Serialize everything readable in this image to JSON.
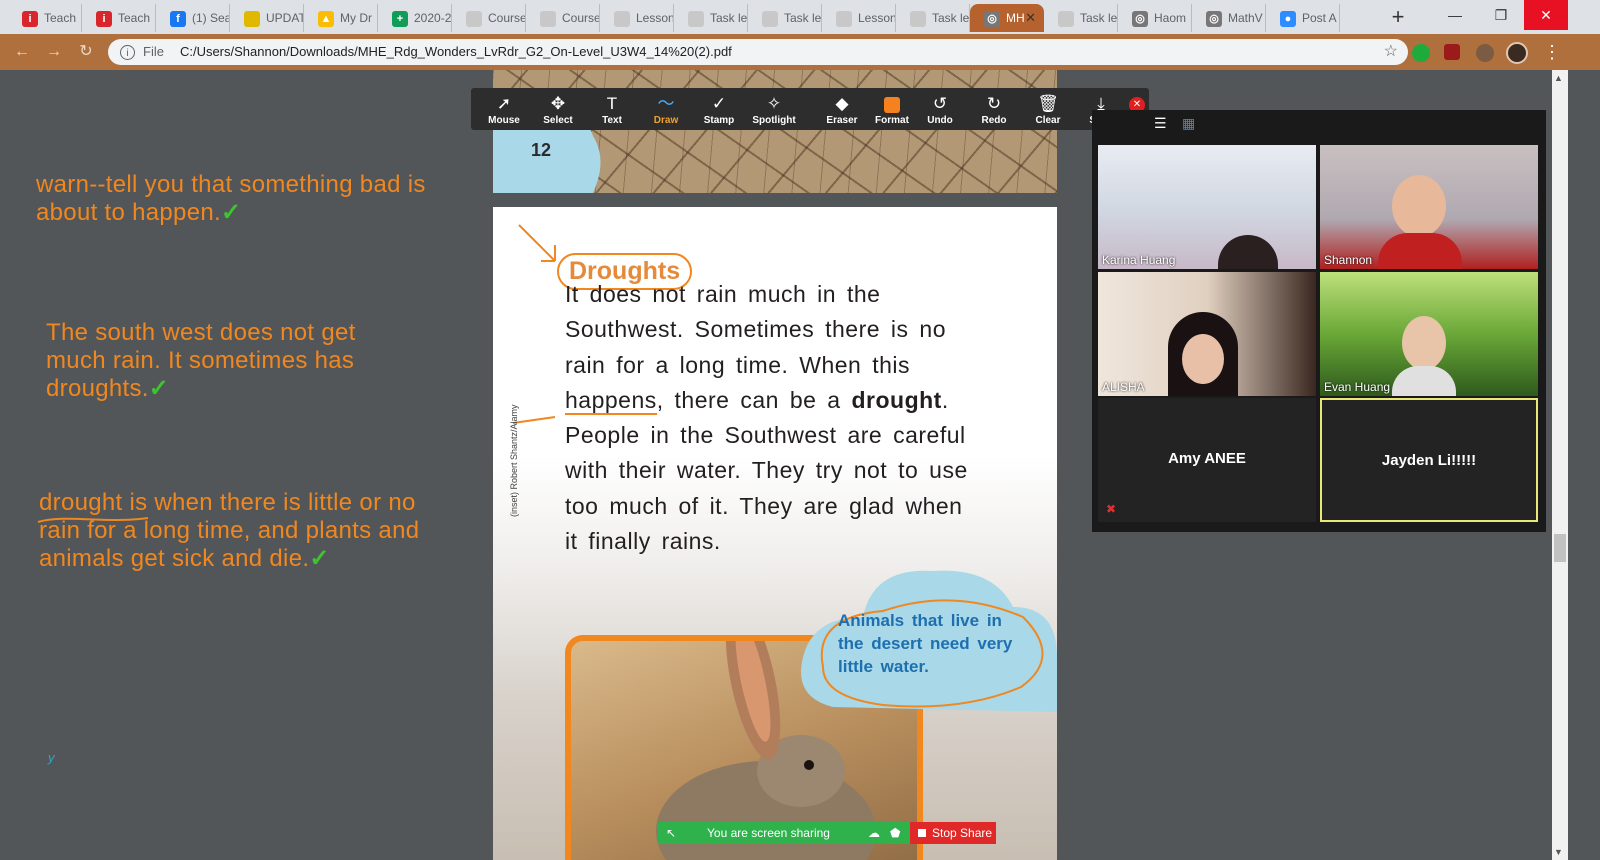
{
  "tabs": [
    {
      "label": "Teach",
      "icon": "red-i-icon"
    },
    {
      "label": "Teach",
      "icon": "red-i-icon"
    },
    {
      "label": "(1) Sea",
      "icon": "facebook-icon"
    },
    {
      "label": "UPDAT",
      "icon": "yellow-circle-icon"
    },
    {
      "label": "My Dr",
      "icon": "drive-icon"
    },
    {
      "label": "2020-2",
      "icon": "green-plus-icon"
    },
    {
      "label": "Course",
      "icon": "doc-icon"
    },
    {
      "label": "Course",
      "icon": "doc-icon"
    },
    {
      "label": "Lesson",
      "icon": "doc-icon"
    },
    {
      "label": "Task le",
      "icon": "doc-icon"
    },
    {
      "label": "Task le",
      "icon": "doc-icon"
    },
    {
      "label": "Lesson",
      "icon": "doc-icon"
    },
    {
      "label": "Task le",
      "icon": "doc-icon"
    },
    {
      "label": "MH",
      "icon": "globe-icon"
    },
    {
      "label": "Task le",
      "icon": "doc-icon"
    },
    {
      "label": "Haom",
      "icon": "globe-icon"
    },
    {
      "label": "MathV",
      "icon": "globe-icon"
    },
    {
      "label": "Post A",
      "icon": "zoom-icon"
    }
  ],
  "address": {
    "scheme_label": "File",
    "url": "C:/Users/Shannon/Downloads/MHE_Rdg_Wonders_LvRdr_G2_On-Level_U3W4_14%20(2).pdf"
  },
  "notes": [
    {
      "text": "warn--tell you that something bad is about to happen.",
      "check": "✓"
    },
    {
      "text": "The south west does not get much rain. It sometimes has droughts.",
      "check": "✓"
    },
    {
      "text": "drought is when there is little or no rain for a long time, and plants and animals get sick and die.",
      "check": "✓"
    },
    {
      "text": "y"
    }
  ],
  "page_top": {
    "page_number": "12"
  },
  "page_main": {
    "heading": "Droughts",
    "lines": [
      "It does not rain much in the",
      "Southwest. Sometimes there is no",
      "rain for a long time. When this"
    ],
    "line4_a": "happens",
    "line4_b": ", there can be a ",
    "line4_bold": "drought",
    "line4_c": ".",
    "lines_rest": [
      "People in the Southwest are careful",
      "with their water. They try not to use",
      "too much of it. They are glad when",
      "it finally rains."
    ],
    "caption": "Animals that live in the desert need very little water.",
    "credit": "(inset) Robert Shantz/Alamy"
  },
  "annotate_toolbar": {
    "tools": [
      {
        "label": "Mouse",
        "icon": "arrow-cursor-icon",
        "glyph": "➚"
      },
      {
        "label": "Select",
        "icon": "move-icon",
        "glyph": "✥"
      },
      {
        "label": "Text",
        "icon": "text-icon",
        "glyph": "T"
      },
      {
        "label": "Draw",
        "icon": "draw-icon",
        "glyph": "〜"
      },
      {
        "label": "Stamp",
        "icon": "check-icon",
        "glyph": "✓"
      },
      {
        "label": "Spotlight",
        "icon": "wand-icon",
        "glyph": "✧"
      },
      {
        "label": "Eraser",
        "icon": "eraser-icon",
        "glyph": "◆"
      },
      {
        "label": "Format",
        "icon": "format-icon",
        "glyph": ""
      },
      {
        "label": "Undo",
        "icon": "undo-icon",
        "glyph": "↺"
      },
      {
        "label": "Redo",
        "icon": "redo-icon",
        "glyph": "↻"
      },
      {
        "label": "Clear",
        "icon": "trash-icon",
        "glyph": "🗑"
      },
      {
        "label": "Save",
        "icon": "save-icon",
        "glyph": "⤓"
      }
    ],
    "active": "Draw",
    "close_glyph": "✕",
    "format_color": "#f5821f"
  },
  "zoom": {
    "participants": [
      {
        "name": "Karina Huang",
        "video": true
      },
      {
        "name": "Shannon",
        "video": true
      },
      {
        "name": "ALISHA",
        "video": true
      },
      {
        "name": "Evan Huang",
        "video": true
      },
      {
        "name": "Amy ANEE",
        "video": false,
        "muted": true
      },
      {
        "name": "Jayden Li!!!!!",
        "video": false,
        "active_speaker": true
      }
    ]
  },
  "share_bar": {
    "status": "You are screen sharing",
    "stop_label": "Stop Share"
  },
  "colors": {
    "annotation_orange": "#f0871f",
    "check_green": "#3ec42f",
    "chrome_frame": "#b0703e",
    "caption_blue": "#1e6fb0"
  }
}
